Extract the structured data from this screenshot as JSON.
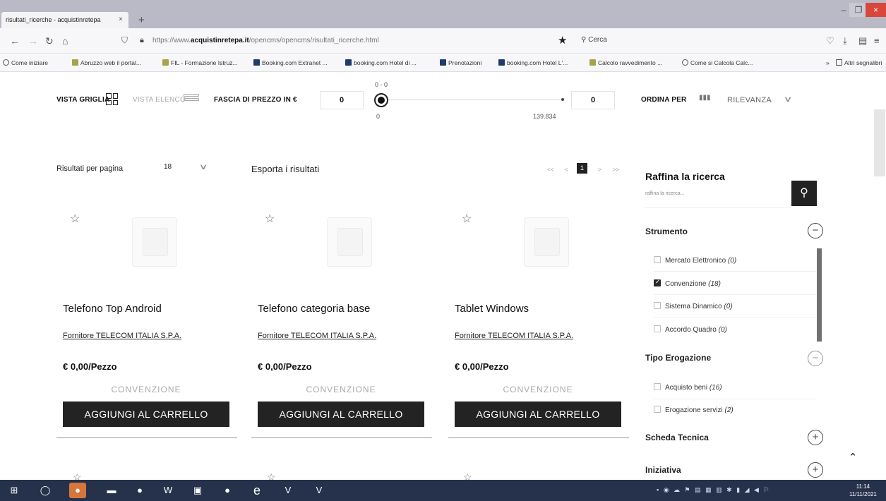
{
  "browser": {
    "tab_title": "risultati_ricerche - acquistinretepa",
    "tab_close": "×",
    "new_tab": "+",
    "url_prefix": "https://www.",
    "url_domain": "acquistinretepa.it",
    "url_path": "/opencms/opencms/risultati_ricerche.html",
    "search_placeholder": "Cerca",
    "window_min": "–",
    "window_max": "❐",
    "window_close": "×"
  },
  "bookmarks": [
    {
      "label": "Come iniziare"
    },
    {
      "label": "Abruzzo web il portal..."
    },
    {
      "label": "FIL - Formazione Istruz..."
    },
    {
      "label": "Booking.com Extranet ..."
    },
    {
      "label": "booking.com Hotel di ..."
    },
    {
      "label": "Prenotazioni"
    },
    {
      "label": "booking.com Hotel L'..."
    },
    {
      "label": "Calcolo ravvedimento ..."
    },
    {
      "label": "Come si Calcola Calc..."
    }
  ],
  "bookmarks_more": "»",
  "bookmarks_other": "Altri segnalibri",
  "toolbar": {
    "grid_view": "VISTA GRIGLIA",
    "list_view": "VISTA ELENCO",
    "price_range_label": "FASCIA DI PREZZO IN €",
    "price_min": "0",
    "price_max": "0",
    "range_label": "0 - 0",
    "slider_min": "0",
    "slider_max": "139.834",
    "sort_label": "ORDINA PER",
    "sort_value": "RILEVANZA"
  },
  "results_bar": {
    "per_page_label": "Risultati per pagina",
    "per_page_value": "18",
    "export_label": "Esporta i risultati",
    "pager_first": "<<",
    "pager_prev": "<",
    "current_page": "1",
    "pager_next": ">",
    "pager_last": ">>"
  },
  "products": [
    {
      "title": "Telefono Top Android",
      "supplier": "Fornitore TELECOM ITALIA S.P.A.",
      "price": "€ 0,00/Pezzo",
      "badge": "CONVENZIONE",
      "button": "AGGIUNGI AL CARRELLO"
    },
    {
      "title": "Telefono categoria base",
      "supplier": "Fornitore TELECOM ITALIA S.P.A.",
      "price": "€ 0,00/Pezzo",
      "badge": "CONVENZIONE",
      "button": "AGGIUNGI AL CARRELLO"
    },
    {
      "title": "Tablet Windows",
      "supplier": "Fornitore TELECOM ITALIA S.P.A.",
      "price": "€ 0,00/Pezzo",
      "badge": "CONVENZIONE",
      "button": "AGGIUNGI AL CARRELLO"
    }
  ],
  "sidebar": {
    "title": "Raffina la ricerca",
    "search_placeholder": "raffina la ricerca...",
    "facets": {
      "strumento": {
        "label": "Strumento",
        "options": [
          {
            "label": "Mercato Elettronico",
            "count": "(0)",
            "checked": false
          },
          {
            "label": "Convenzione",
            "count": "(18)",
            "checked": true
          },
          {
            "label": "Sistema Dinamico",
            "count": "(0)",
            "checked": false
          },
          {
            "label": "Accordo Quadro",
            "count": "(0)",
            "checked": false
          }
        ]
      },
      "tipo_erogazione": {
        "label": "Tipo Erogazione",
        "options": [
          {
            "label": "Acquisto beni",
            "count": "(16)",
            "checked": false
          },
          {
            "label": "Erogazione servizi",
            "count": "(2)",
            "checked": false
          }
        ]
      },
      "scheda_tecnica": {
        "label": "Scheda Tecnica"
      },
      "iniziativa": {
        "label": "Iniziativa"
      }
    }
  },
  "taskbar": {
    "time": "11:14",
    "date": "11/11/2021"
  },
  "colors": {
    "accent_dark": "#232323",
    "taskbar": "#26324b",
    "tab_strip": "#b9bac6"
  }
}
